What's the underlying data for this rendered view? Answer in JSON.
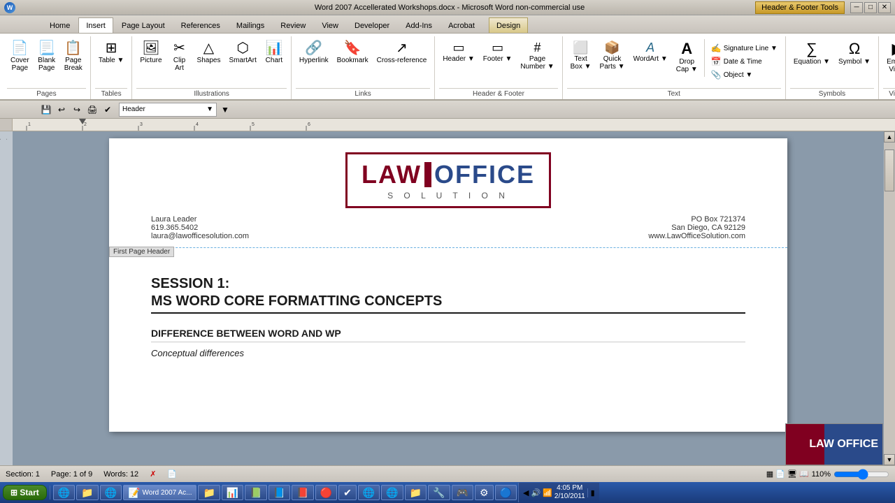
{
  "window": {
    "title": "Word 2007 Accellerated Workshops.docx - Microsoft Word non-commercial use",
    "header_tools_label": "Header & Footer Tools",
    "controls": [
      "─",
      "□",
      "✕"
    ]
  },
  "ribbon": {
    "tabs": [
      "Home",
      "Insert",
      "Page Layout",
      "References",
      "Mailings",
      "Review",
      "View",
      "Developer",
      "Add-Ins",
      "Acrobat",
      "Design"
    ],
    "active_tab": "Insert",
    "groups": {
      "pages": {
        "label": "Pages",
        "buttons": [
          {
            "id": "cover-page",
            "icon": "📄",
            "label": "Cover\nPage"
          },
          {
            "id": "blank-page",
            "icon": "📃",
            "label": "Blank\nPage"
          },
          {
            "id": "page-break",
            "icon": "📋",
            "label": "Page\nBreak"
          }
        ]
      },
      "tables": {
        "label": "Tables",
        "buttons": [
          {
            "id": "table",
            "icon": "⊞",
            "label": "Table"
          }
        ]
      },
      "illustrations": {
        "label": "Illustrations",
        "buttons": [
          {
            "id": "picture",
            "icon": "🖼",
            "label": "Picture"
          },
          {
            "id": "clip-art",
            "icon": "✂",
            "label": "Clip\nArt"
          },
          {
            "id": "shapes",
            "icon": "△",
            "label": "Shapes"
          },
          {
            "id": "smartart",
            "icon": "⬡",
            "label": "SmartArt"
          },
          {
            "id": "chart",
            "icon": "📊",
            "label": "Chart"
          }
        ]
      },
      "links": {
        "label": "Links",
        "buttons": [
          {
            "id": "hyperlink",
            "icon": "🔗",
            "label": "Hyperlink"
          },
          {
            "id": "bookmark",
            "icon": "🔖",
            "label": "Bookmark"
          },
          {
            "id": "crossref",
            "icon": "↗",
            "label": "Cross-reference"
          }
        ]
      },
      "header_footer": {
        "label": "Header & Footer",
        "buttons": [
          {
            "id": "header",
            "icon": "▭",
            "label": "Header"
          },
          {
            "id": "footer",
            "icon": "▭",
            "label": "Footer"
          },
          {
            "id": "page-number",
            "icon": "#",
            "label": "Page\nNumber"
          }
        ]
      },
      "text": {
        "label": "Text",
        "buttons": [
          {
            "id": "text-box",
            "icon": "⬜",
            "label": "Text\nBox"
          },
          {
            "id": "quick-parts",
            "icon": "📦",
            "label": "Quick\nParts"
          },
          {
            "id": "wordart",
            "icon": "A",
            "label": "WordArt"
          },
          {
            "id": "dropcap",
            "icon": "A",
            "label": "Drop\nCap"
          }
        ],
        "small_buttons": [
          {
            "id": "signature-line",
            "icon": "✍",
            "label": "Signature Line"
          },
          {
            "id": "date-time",
            "icon": "📅",
            "label": "Date & Time"
          },
          {
            "id": "object",
            "icon": "📎",
            "label": "Object"
          }
        ]
      },
      "symbols": {
        "label": "Symbols",
        "buttons": [
          {
            "id": "equation",
            "icon": "∑",
            "label": "Equation"
          },
          {
            "id": "symbol",
            "icon": "Ω",
            "label": "Symbol"
          }
        ]
      },
      "video": {
        "label": "Video",
        "buttons": [
          {
            "id": "embed-video",
            "icon": "▶",
            "label": "Embed\nVideo"
          }
        ]
      }
    }
  },
  "quick_access": {
    "buttons": [
      "💾",
      "↩",
      "↪",
      "🖨",
      "✔"
    ]
  },
  "document": {
    "header": {
      "name": "Laura Leader",
      "phone": "619.365.5402",
      "email": "laura@lawofficesolution.com",
      "address": "PO Box 721374",
      "city": "San Diego, CA 92129",
      "website": "www.LawOfficeSolution.com",
      "first_page_label": "First Page Header"
    },
    "logo": {
      "law": "LAW",
      "office": "OFFICE",
      "solution": "S  O  L  U  T  I  O  N"
    },
    "content": {
      "session_number": "SESSION 1:",
      "session_title": "MS WORD CORE FORMATTING CONCEPTS",
      "section1_title": "DIFFERENCE BETWEEN WORD AND WP",
      "section1_sub": "Conceptual differences"
    }
  },
  "status_bar": {
    "section": "Section: 1",
    "page": "Page: 1 of 9",
    "words": "Words: 12",
    "zoom": "110%",
    "date": "2/10/2011",
    "time": "4:05 PM"
  },
  "taskbar": {
    "start": "Start",
    "items": [
      {
        "icon": "💻",
        "label": "",
        "active": false
      },
      {
        "icon": "📁",
        "label": "",
        "active": false
      },
      {
        "icon": "🌐",
        "label": "",
        "active": false
      },
      {
        "icon": "📝",
        "label": "Word 2007 Ac...",
        "active": true
      },
      {
        "icon": "📁",
        "label": "",
        "active": false
      },
      {
        "icon": "📊",
        "label": "",
        "active": false
      },
      {
        "icon": "📗",
        "label": "",
        "active": false
      },
      {
        "icon": "📘",
        "label": "",
        "active": false
      },
      {
        "icon": "📕",
        "label": "",
        "active": false
      },
      {
        "icon": "🔴",
        "label": "",
        "active": false
      },
      {
        "icon": "✔",
        "label": "",
        "active": false
      },
      {
        "icon": "🌐",
        "label": "",
        "active": false
      },
      {
        "icon": "🌐",
        "label": "",
        "active": false
      },
      {
        "icon": "📁",
        "label": "",
        "active": false
      },
      {
        "icon": "🔧",
        "label": "",
        "active": false
      },
      {
        "icon": "🎮",
        "label": "",
        "active": false
      },
      {
        "icon": "⚙",
        "label": "",
        "active": false
      },
      {
        "icon": "🔵",
        "label": "",
        "active": false
      }
    ]
  }
}
